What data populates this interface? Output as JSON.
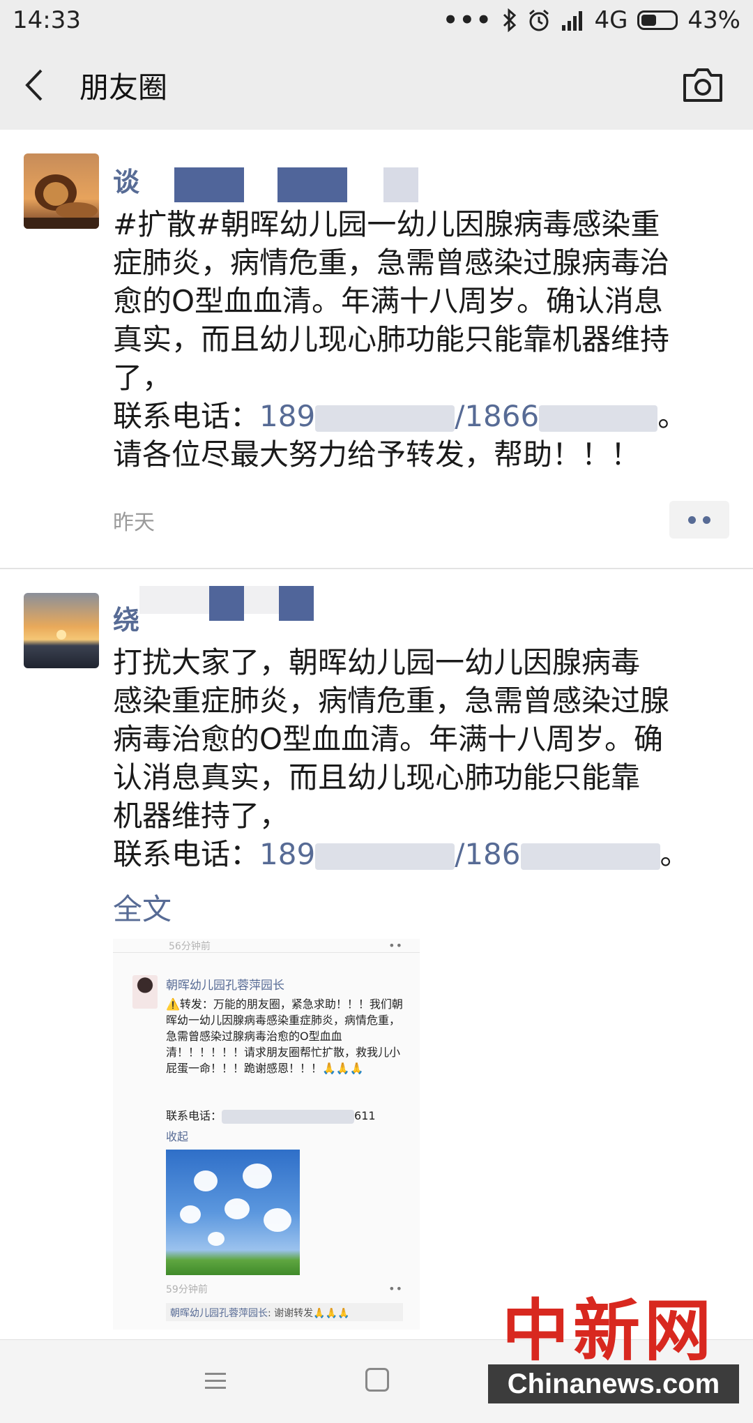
{
  "status_bar": {
    "time": "14:33",
    "dots": "•••",
    "network": "4G",
    "battery": "43%"
  },
  "nav": {
    "title": "朋友圈"
  },
  "posts": [
    {
      "nick": "谈",
      "lines": [
        "#扩散#朝晖幼儿园一幼儿因腺病毒感染重",
        "症肺炎，病情危重，急需曾感染过腺病毒治",
        "愈的O型血血清。年满十八周岁。确认消息",
        "真实，而且幼儿现心肺功能只能靠机器维持",
        "了，"
      ],
      "phone_label": "联系电话：",
      "phone_a": "189",
      "phone_sep": "/1866",
      "phone_end": "。",
      "last_line": "请各位尽最大努力给予转发，帮助！！！",
      "time": "昨天"
    },
    {
      "nick": "绕",
      "lines": [
        "打扰大家了，朝晖幼儿园一幼儿因腺病毒",
        "感染重症肺炎，病情危重，急需曾感染过腺",
        "病毒治愈的O型血血清。年满十八周岁。确",
        "认消息真实，而且幼儿现心肺功能只能靠",
        "机器维持了，"
      ],
      "phone_label": "联系电话：",
      "phone_a": "189",
      "phone_sep": "/186",
      "phone_end": "。",
      "full_text": "全文"
    }
  ],
  "embedded": {
    "top_time": "56分钟前",
    "dots": "••",
    "name": "朝晖幼儿园孔蓉萍园长",
    "text": "⚠️转发：万能的朋友圈，紧急求助！！！我们朝晖幼一幼儿因腺病毒感染重症肺炎，病情危重，急需曾感染过腺病毒治愈的O型血血清！！！！！！请求朋友圈帮忙扩散，救我儿小屁蛋一命！！！跪谢感恩！！！🙏🙏🙏",
    "phone_label": "联系电话：",
    "phone_tail": "611",
    "collapse": "收起",
    "time": "59分钟前",
    "comment_name": "朝晖幼儿园孔蓉萍园长",
    "comment_text": ": 谢谢转发🙏🙏🙏"
  },
  "watermark": {
    "cn": "中新网",
    "en": "Chinanews.com"
  },
  "colors": {
    "link": "#576b95",
    "bar_bg": "#ededed",
    "watermark_red": "#d8281f"
  }
}
